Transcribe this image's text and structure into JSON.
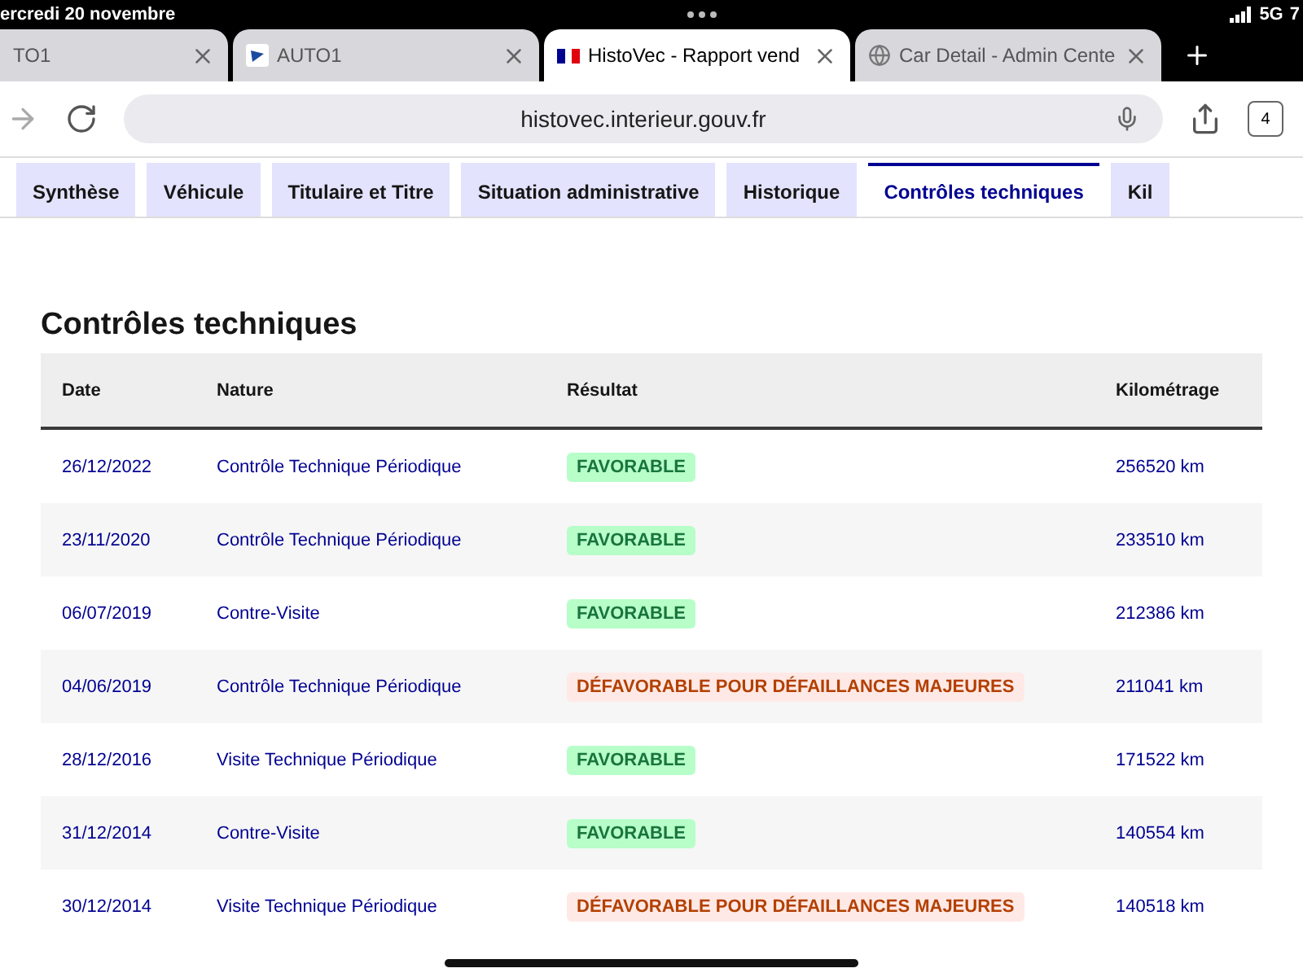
{
  "status_bar": {
    "date": "ercredi 20 novembre",
    "network": "5G",
    "extra": "7"
  },
  "browser_tabs": [
    {
      "title": "TO1",
      "selected": false
    },
    {
      "title": "AUTO1",
      "selected": false
    },
    {
      "title": "HistoVec - Rapport vend",
      "selected": true
    },
    {
      "title": "Car Detail - Admin Cente",
      "selected": false
    }
  ],
  "address_bar": {
    "url": "histovec.interieur.gouv.fr"
  },
  "tab_count": "4",
  "page_tabs": [
    {
      "label": "Synthèse",
      "selected": false
    },
    {
      "label": "Véhicule",
      "selected": false
    },
    {
      "label": "Titulaire et Titre",
      "selected": false
    },
    {
      "label": "Situation administrative",
      "selected": false
    },
    {
      "label": "Historique",
      "selected": false
    },
    {
      "label": "Contrôles techniques",
      "selected": true
    },
    {
      "label": "Kil",
      "selected": false
    }
  ],
  "section_title": "Contrôles techniques",
  "table": {
    "columns": [
      "Date",
      "Nature",
      "Résultat",
      "Kilométrage"
    ],
    "rows": [
      {
        "date": "26/12/2022",
        "nature": "Contrôle Technique Périodique",
        "result": "FAVORABLE",
        "kind": "favorable",
        "mileage": "256520 km"
      },
      {
        "date": "23/11/2020",
        "nature": "Contrôle Technique Périodique",
        "result": "FAVORABLE",
        "kind": "favorable",
        "mileage": "233510 km"
      },
      {
        "date": "06/07/2019",
        "nature": "Contre-Visite",
        "result": "FAVORABLE",
        "kind": "favorable",
        "mileage": "212386 km"
      },
      {
        "date": "04/06/2019",
        "nature": "Contrôle Technique Périodique",
        "result": "DÉFAVORABLE POUR DÉFAILLANCES MAJEURES",
        "kind": "unfavorable",
        "mileage": "211041 km"
      },
      {
        "date": "28/12/2016",
        "nature": "Visite Technique Périodique",
        "result": "FAVORABLE",
        "kind": "favorable",
        "mileage": "171522 km"
      },
      {
        "date": "31/12/2014",
        "nature": "Contre-Visite",
        "result": "FAVORABLE",
        "kind": "favorable",
        "mileage": "140554 km"
      },
      {
        "date": "30/12/2014",
        "nature": "Visite Technique Périodique",
        "result": "DÉFAVORABLE POUR DÉFAILLANCES MAJEURES",
        "kind": "unfavorable",
        "mileage": "140518 km"
      }
    ]
  }
}
